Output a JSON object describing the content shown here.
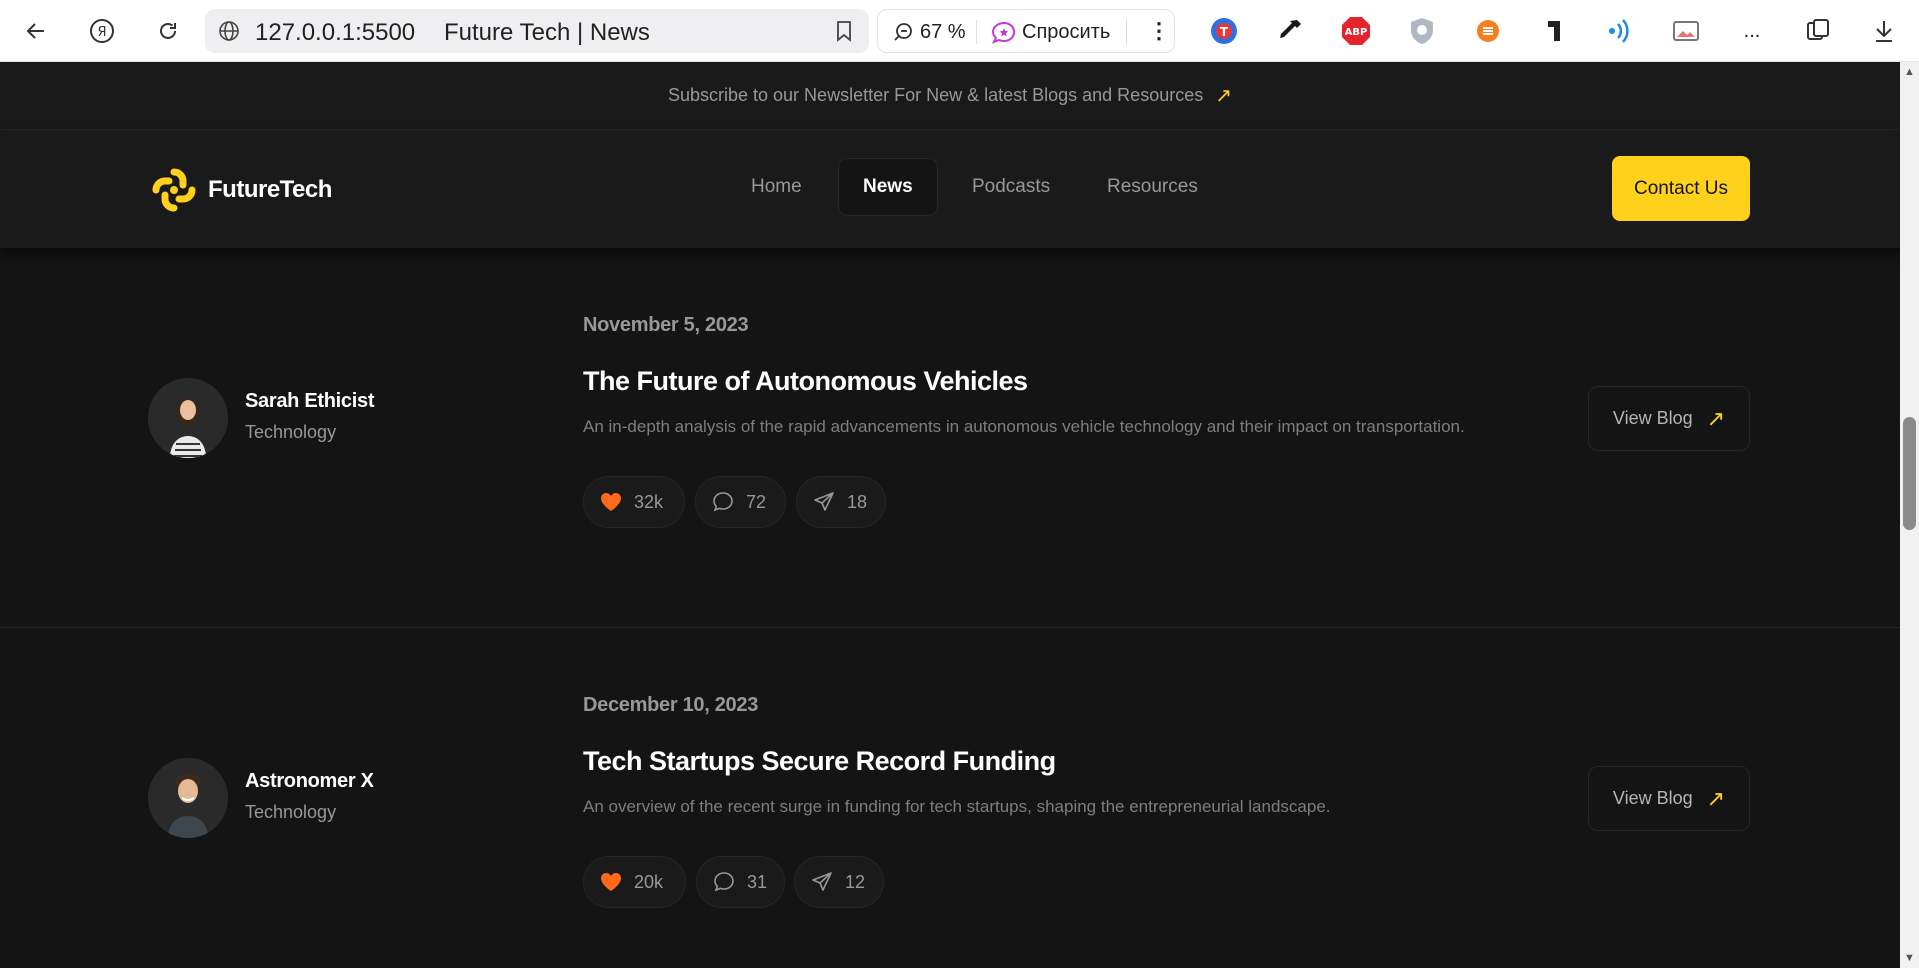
{
  "browser": {
    "url": "127.0.0.1:5500",
    "tab_title": "Future Tech | News",
    "zoom": "67 %",
    "ask_label": "Спросить",
    "more_label": "..."
  },
  "newsletter": {
    "text": "Subscribe to our Newsletter For New & latest Blogs and Resources",
    "arrow": "↗"
  },
  "header": {
    "logo_text": "FutureTech",
    "nav": [
      "Home",
      "News",
      "Podcasts",
      "Resources"
    ],
    "active_nav": "News",
    "contact_label": "Contact Us"
  },
  "posts": [
    {
      "author": "Sarah Ethicist",
      "category": "Technology",
      "date": "November 5, 2023",
      "title": "The Future of Autonomous Vehicles",
      "description": "An in-depth analysis of the rapid advancements in autonomous vehicle technology and their impact on transportation.",
      "likes": "32k",
      "comments": "72",
      "shares": "18",
      "button": "View Blog"
    },
    {
      "author": "Astronomer X",
      "category": "Technology",
      "date": "December 10, 2023",
      "title": "Tech Startups Secure Record Funding",
      "description": "An overview of the recent surge in funding for tech startups, shaping the entrepreneurial landscape.",
      "likes": "20k",
      "comments": "31",
      "shares": "12",
      "button": "View Blog"
    }
  ],
  "colors": {
    "accent": "#ffd11a",
    "heart": "#ff6a19",
    "background": "#141414",
    "panel": "#1a1a1a",
    "border": "#262626"
  }
}
